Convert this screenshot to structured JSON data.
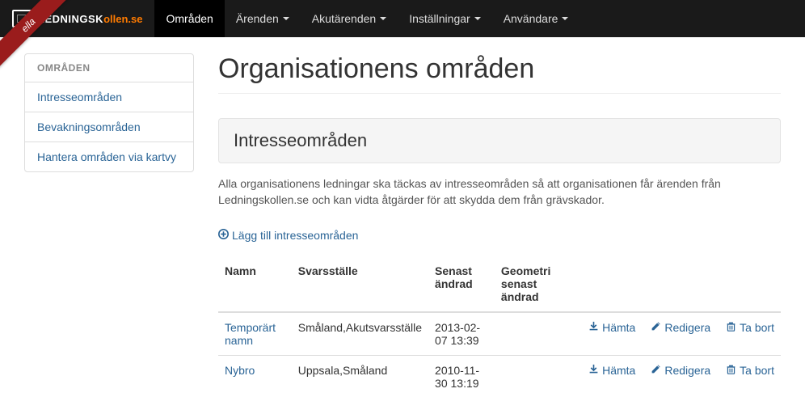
{
  "ribbon": "ella",
  "logo": {
    "part1": "LEDNINGSK",
    "part2": "ollen.se"
  },
  "nav": {
    "items": [
      {
        "label": "Områden",
        "dropdown": false,
        "active": true
      },
      {
        "label": "Ärenden",
        "dropdown": true,
        "active": false
      },
      {
        "label": "Akutärenden",
        "dropdown": true,
        "active": false
      },
      {
        "label": "Inställningar",
        "dropdown": true,
        "active": false
      },
      {
        "label": "Användare",
        "dropdown": true,
        "active": false
      }
    ]
  },
  "sidebar": {
    "heading": "OMRÅDEN",
    "items": [
      {
        "label": "Intresseområden"
      },
      {
        "label": "Bevakningsområden"
      },
      {
        "label": "Hantera områden via kartvy"
      }
    ]
  },
  "page": {
    "title": "Organisationens områden",
    "section_title": "Intresseområden",
    "description": "Alla organisationens ledningar ska täckas av intresseområden så att organisationen får ärenden från Ledningskollen.se och kan vidta åtgärder för att skydda dem från grävskador.",
    "add_label": "Lägg till intresseområden"
  },
  "table": {
    "headers": {
      "name": "Namn",
      "svarsstalle": "Svarsställe",
      "senast": "Senast ändrad",
      "geometri": "Geometri senast ändrad"
    },
    "actions": {
      "download": "Hämta",
      "edit": "Redigera",
      "delete": "Ta bort"
    },
    "rows": [
      {
        "name": "Temporärt namn",
        "svarsstalle": "Småland,Akutsvarsställe",
        "senast": "2013-02-07 13:39",
        "geometri": ""
      },
      {
        "name": "Nybro",
        "svarsstalle": "Uppsala,Småland",
        "senast": "2010-11-30 13:19",
        "geometri": ""
      }
    ]
  }
}
